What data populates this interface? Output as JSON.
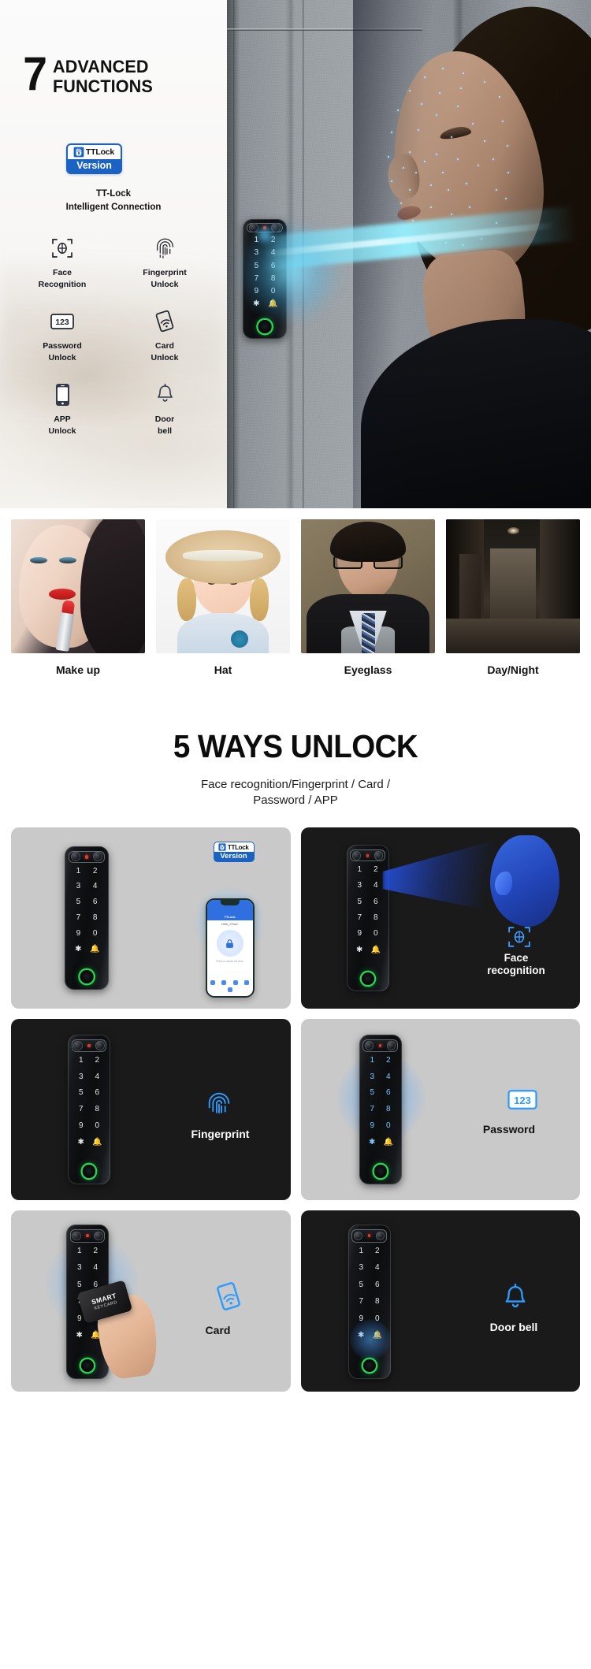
{
  "hero": {
    "headline_number": "7",
    "headline_line1": "ADVANCED",
    "headline_line2": "FUNCTIONS",
    "badge": {
      "brand": "TTLock",
      "version": "Version"
    },
    "badge_caption_line1": "TT-Lock",
    "badge_caption_line2": "Intelligent Connection",
    "features": [
      {
        "icon": "face-scan-icon",
        "line1": "Face",
        "line2": "Recognition"
      },
      {
        "icon": "fingerprint-icon",
        "line1": "Fingerprint",
        "line2": "Unlock"
      },
      {
        "icon": "keypad-123-icon",
        "line1": "Password",
        "line2": "Unlock"
      },
      {
        "icon": "nfc-card-icon",
        "line1": "Card",
        "line2": "Unlock"
      },
      {
        "icon": "smartphone-icon",
        "line1": "APP",
        "line2": "Unlock"
      },
      {
        "icon": "doorbell-icon",
        "line1": "Door",
        "line2": "bell"
      }
    ],
    "keypad_digits": [
      "1",
      "2",
      "3",
      "4",
      "5",
      "6",
      "7",
      "8",
      "9",
      "0",
      "*",
      "bell"
    ]
  },
  "photo_strip": [
    {
      "name": "makeup-photo",
      "caption": "Make up"
    },
    {
      "name": "hat-photo",
      "caption": "Hat"
    },
    {
      "name": "eyeglass-photo",
      "caption": "Eyeglass"
    },
    {
      "name": "daynight-photo",
      "caption": "Day/Night"
    }
  ],
  "section": {
    "title": "5 WAYS UNLOCK",
    "subtitle_line1": "Face recognition/Fingerprint / Card /",
    "subtitle_line2": "Password / APP"
  },
  "cards": [
    {
      "name": "card-ttlock-app",
      "theme": "light",
      "label": "",
      "label2": "",
      "badge_brand": "TTLock",
      "badge_version": "Version",
      "phone_app_title": "TTLock",
      "phone_device": "Hello_XFace",
      "phone_hint": "Press to unlock the door"
    },
    {
      "name": "card-face-recognition",
      "theme": "dark",
      "label": "Face",
      "label2": "recognition",
      "icon": "face-scan-icon"
    },
    {
      "name": "card-fingerprint",
      "theme": "dark",
      "label": "Fingerprint",
      "label2": "",
      "icon": "fingerprint-icon"
    },
    {
      "name": "card-password",
      "theme": "light",
      "label": "Password",
      "label2": "",
      "icon": "keypad-123-icon"
    },
    {
      "name": "card-nfc",
      "theme": "light",
      "label": "Card",
      "label2": "",
      "icon": "nfc-card-icon",
      "keycard_brand": "SMART",
      "keycard_sub": "KEYCARD"
    },
    {
      "name": "card-doorbell",
      "theme": "dark",
      "label": "Door bell",
      "label2": "",
      "icon": "doorbell-icon"
    }
  ],
  "colors": {
    "brand_blue": "#1a62c4",
    "accent_blue": "#2f8fe0",
    "fingerprint_ring_green": "#21d850",
    "scan_cyan": "#8ce4ff",
    "card_light_bg": "#c9c9c9",
    "card_dark_bg": "#1a1a1a"
  }
}
